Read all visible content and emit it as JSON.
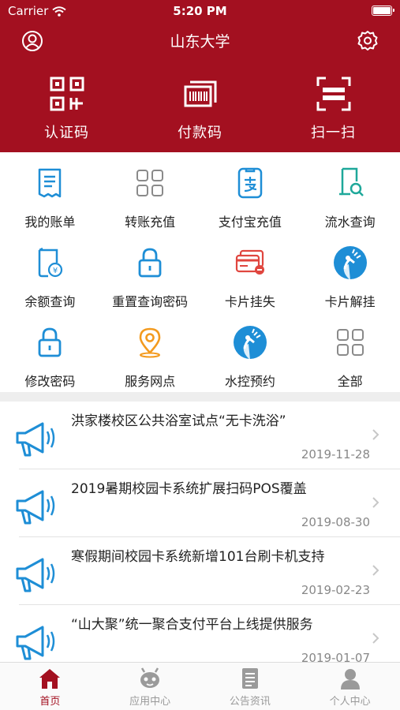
{
  "status_bar": {
    "carrier": "Carrier",
    "time": "5:20 PM"
  },
  "header": {
    "title": "山东大学"
  },
  "quick_actions": [
    {
      "label": "认证码",
      "icon": "qr-code-icon"
    },
    {
      "label": "付款码",
      "icon": "barcode-icon"
    },
    {
      "label": "扫一扫",
      "icon": "scan-icon"
    }
  ],
  "services": [
    {
      "label": "我的账单",
      "icon": "bill-icon"
    },
    {
      "label": "转账充值",
      "icon": "grid-icon"
    },
    {
      "label": "支付宝充值",
      "icon": "alipay-icon"
    },
    {
      "label": "流水查询",
      "icon": "flow-search-icon"
    },
    {
      "label": "余额查询",
      "icon": "balance-icon"
    },
    {
      "label": "重置查询密码",
      "icon": "lock-icon"
    },
    {
      "label": "卡片挂失",
      "icon": "card-loss-icon"
    },
    {
      "label": "卡片解挂",
      "icon": "shower-icon"
    },
    {
      "label": "修改密码",
      "icon": "lock-icon"
    },
    {
      "label": "服务网点",
      "icon": "location-pin-icon"
    },
    {
      "label": "水控预约",
      "icon": "shower-icon"
    },
    {
      "label": "全部",
      "icon": "grid-icon"
    }
  ],
  "news": [
    {
      "title": "洪家楼校区公共浴室试点“无卡洗浴”",
      "date": "2019-11-28"
    },
    {
      "title": "2019暑期校园卡系统扩展扫码POS覆盖",
      "date": "2019-08-30"
    },
    {
      "title": "寒假期间校园卡系统新增101台刷卡机支持",
      "date": "2019-02-23"
    },
    {
      "title": "“山大聚”统一聚合支付平台上线提供服务",
      "date": "2019-01-07"
    }
  ],
  "tabs": [
    {
      "label": "首页",
      "icon": "home-icon",
      "active": true
    },
    {
      "label": "应用中心",
      "icon": "robot-icon",
      "active": false
    },
    {
      "label": "公告资讯",
      "icon": "document-icon",
      "active": false
    },
    {
      "label": "个人中心",
      "icon": "person-icon",
      "active": false
    }
  ],
  "colors": {
    "brand": "#a31020",
    "icon_blue": "#1e8ed6",
    "icon_teal": "#1ea89a",
    "icon_red": "#e0463f",
    "icon_orange": "#f39a1e"
  }
}
